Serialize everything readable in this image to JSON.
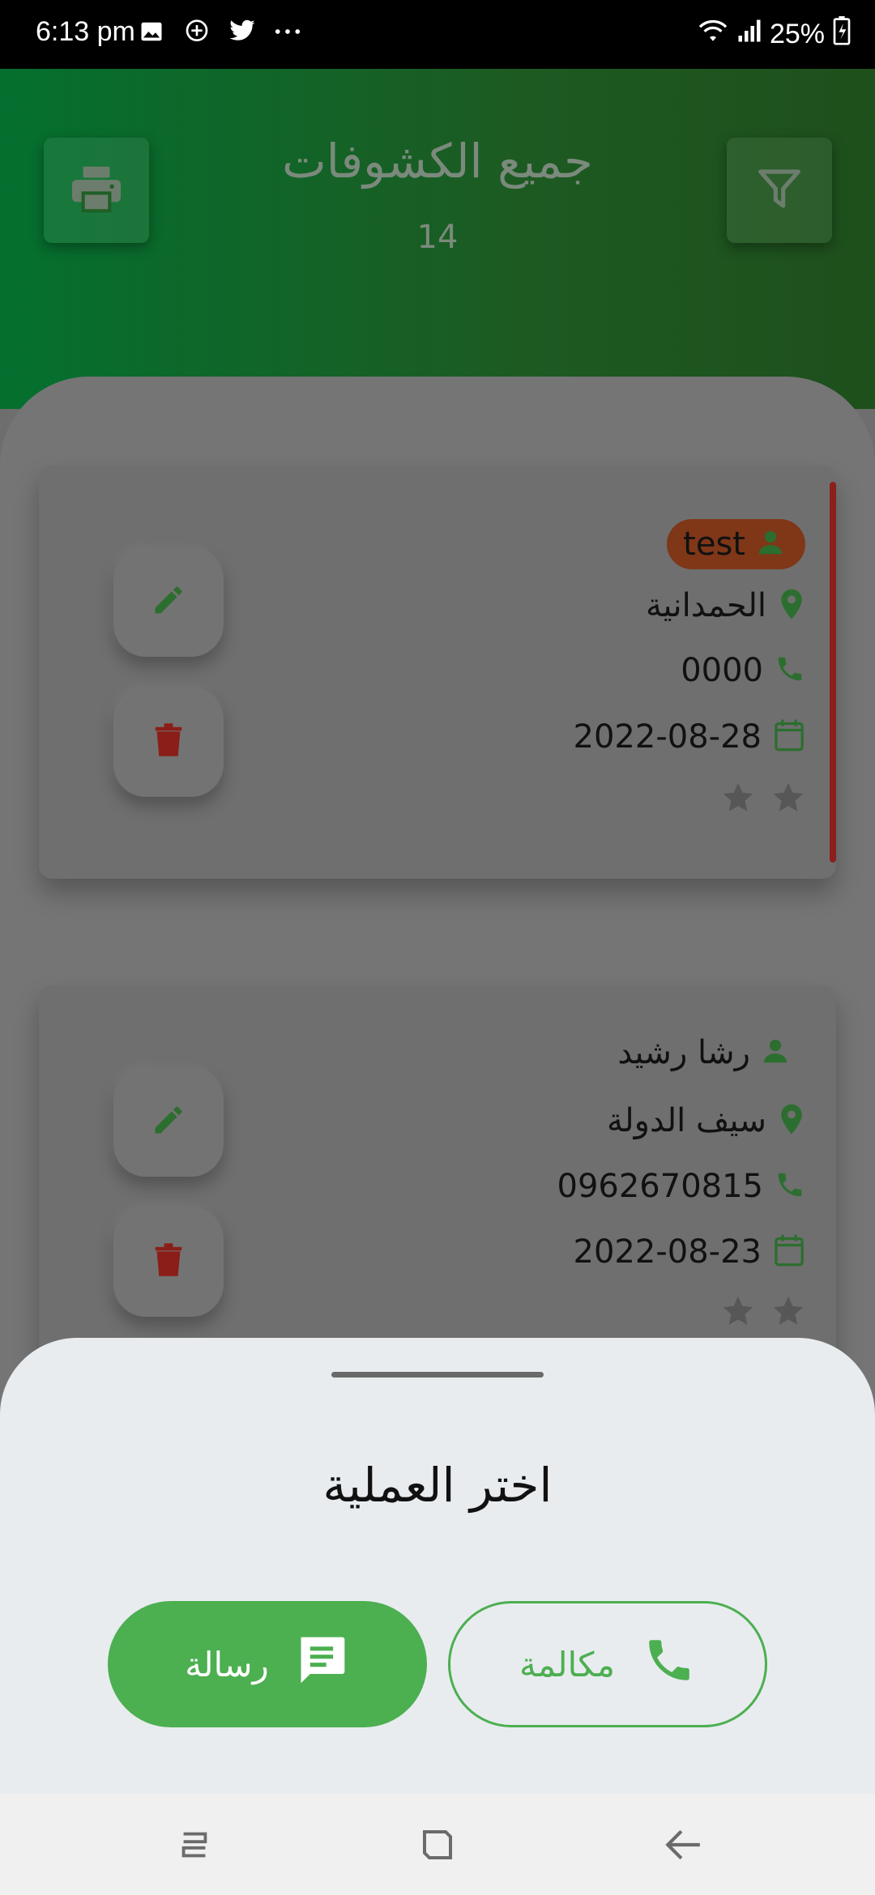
{
  "status_bar": {
    "time": "6:13 pm",
    "battery": "25%",
    "icons_left": [
      "image-icon",
      "plus-circle-icon",
      "twitter-icon",
      "more-dots-icon"
    ],
    "icons_right": [
      "wifi-icon",
      "signal-icon",
      "battery-icon"
    ]
  },
  "header": {
    "title": "جميع الكشوفات",
    "count": "14",
    "print_icon": "printer-icon",
    "filter_icon": "filter-icon"
  },
  "records": [
    {
      "name": "test",
      "location": "الحمدانية",
      "phone": "0000",
      "date": "2022-08-28",
      "highlighted": true
    },
    {
      "name": "رشا رشيد",
      "location": "سيف الدولة",
      "phone": "0962670815",
      "date": "2022-08-23",
      "highlighted": false
    }
  ],
  "sheet": {
    "title": "اختر العملية",
    "message_label": "رسالة",
    "call_label": "مكالمة"
  },
  "colors": {
    "accent_green": "#4caf50",
    "header_green": "#04702f",
    "delete_red": "#b3261e",
    "badge": "#7f3718"
  }
}
